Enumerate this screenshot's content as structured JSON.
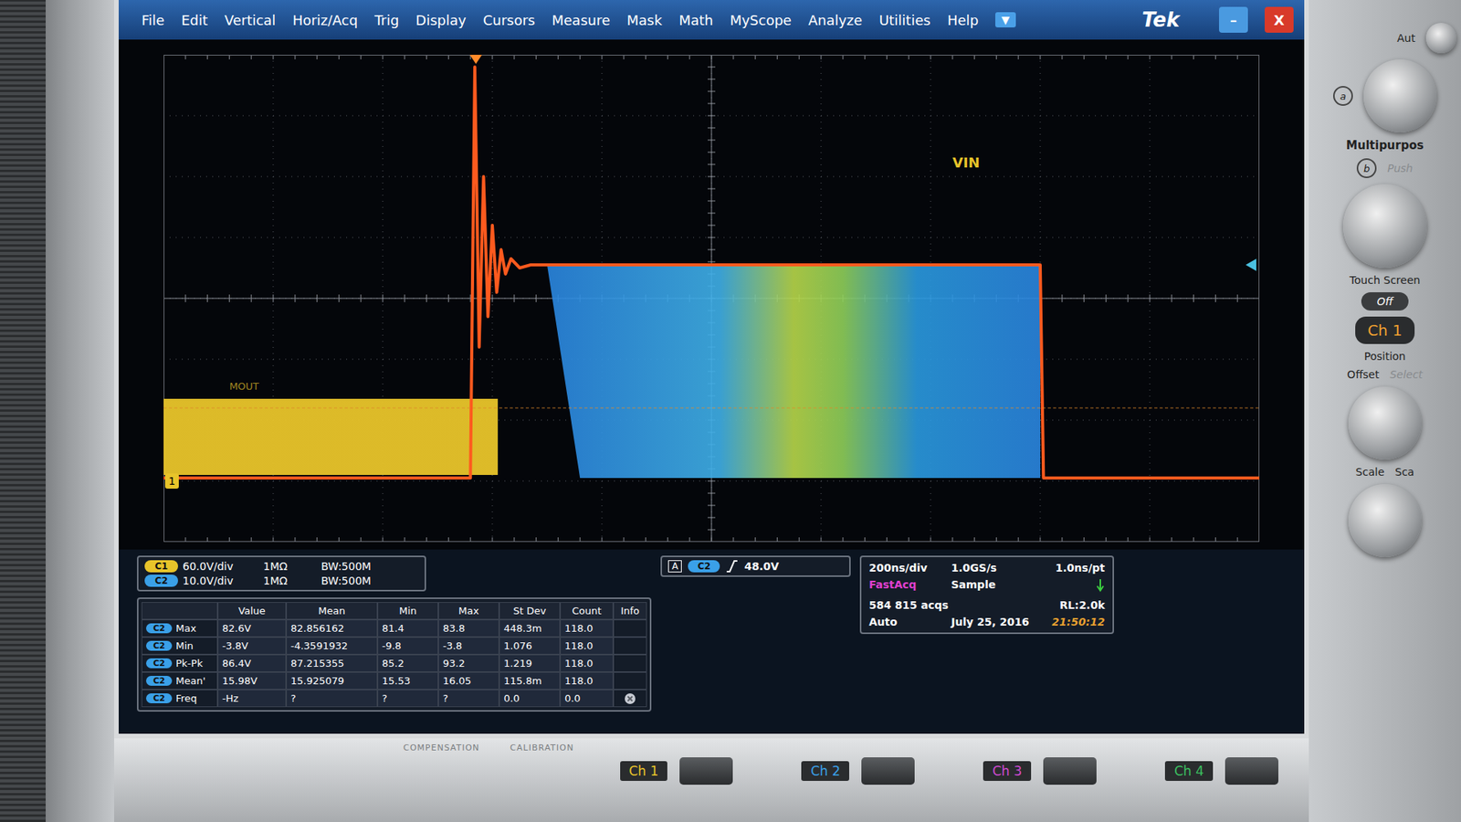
{
  "window": {
    "brand": "Tek",
    "menu": [
      "File",
      "Edit",
      "Vertical",
      "Horiz/Acq",
      "Trig",
      "Display",
      "Cursors",
      "Measure",
      "Mask",
      "Math",
      "MyScope",
      "Analyze",
      "Utilities",
      "Help"
    ],
    "dropdown": "▼",
    "minimize": "–",
    "close": "X"
  },
  "waveform": {
    "label": "VIN",
    "ref_label": "MOUT",
    "channel_marker": "1",
    "time_range_ns": [
      -1000,
      1000
    ],
    "volts_per_div": 10,
    "offset_div": -3,
    "series": [
      {
        "name": "envelope",
        "kind": "fill",
        "gradient": true,
        "color": "#2a86e0",
        "t": [
          -300,
          600,
          600,
          -240
        ],
        "v": [
          35.5,
          35.5,
          0.5,
          0.5
        ]
      },
      {
        "name": "band",
        "kind": "fill",
        "gradient": false,
        "color": "#e8c42a",
        "t": [
          -1000,
          -390,
          -390,
          -1000
        ],
        "v": [
          13.5,
          13.5,
          1,
          1
        ]
      },
      {
        "name": "trace",
        "kind": "line",
        "gradient": false,
        "color": "#ff5a1e",
        "t": [
          -1000,
          -440,
          -432,
          -424,
          -416,
          -408,
          -400,
          -392,
          -384,
          -376,
          -366,
          -350,
          -330,
          600,
          606,
          1000
        ],
        "v": [
          0.5,
          0.5,
          68,
          22,
          50,
          27,
          42,
          31,
          38,
          34,
          36.5,
          35,
          35.5,
          35.5,
          0.5,
          0.5
        ]
      }
    ]
  },
  "channels": [
    {
      "badge": "C1",
      "scale": "60.0V/div",
      "impedance": "1MΩ",
      "bandwidth": "BW:500M",
      "color": "#e8c42a"
    },
    {
      "badge": "C2",
      "scale": "10.0V/div",
      "impedance": "1MΩ",
      "bandwidth": "BW:500M",
      "color": "#3aa0e8"
    }
  ],
  "trigger": {
    "mode": "A",
    "source": "C2",
    "level": "48.0V"
  },
  "acquisition": {
    "timebase": "200ns/div",
    "sample_rate": "1.0GS/s",
    "resolution": "1.0ns/pt",
    "mode": "FastAcq",
    "sampling": "Sample",
    "acqs": "584 815 acqs",
    "record_length": "RL:2.0k",
    "trigger_mode": "Auto",
    "date": "July 25, 2016",
    "time": "21:50:12"
  },
  "measurements": {
    "columns": [
      "",
      "Value",
      "Mean",
      "Min",
      "Max",
      "St Dev",
      "Count",
      "Info"
    ],
    "rows": [
      {
        "source": "C2",
        "name": "Max",
        "cells": [
          "82.6V",
          "82.856162",
          "81.4",
          "83.8",
          "448.3m",
          "118.0"
        ],
        "warning": false
      },
      {
        "source": "C2",
        "name": "Min",
        "cells": [
          "-3.8V",
          "-4.3591932",
          "-9.8",
          "-3.8",
          "1.076",
          "118.0"
        ],
        "warning": false
      },
      {
        "source": "C2",
        "name": "Pk-Pk",
        "cells": [
          "86.4V",
          "87.215355",
          "85.2",
          "93.2",
          "1.219",
          "118.0"
        ],
        "warning": false
      },
      {
        "source": "C2",
        "name": "Mean'",
        "cells": [
          "15.98V",
          "15.925079",
          "15.53",
          "16.05",
          "115.8m",
          "118.0"
        ],
        "warning": false
      },
      {
        "source": "C2",
        "name": "Freq",
        "cells": [
          "-Hz",
          "?",
          "?",
          "?",
          "0.0",
          "0.0"
        ],
        "warning": true
      }
    ]
  },
  "front_panel": {
    "top_label": "Aut",
    "a": "a",
    "multipurpose": "Multipurpos",
    "b": "b",
    "push": "Push",
    "touch_screen": "Touch Screen",
    "touch_state": "Off",
    "ch_button": "Ch 1",
    "position": "Position",
    "offset": "Offset",
    "select": "Select",
    "scale": "Scale",
    "scale2": "Sca"
  },
  "bottom": {
    "labels": [
      "COMPENSATION",
      "CALIBRATION"
    ],
    "channels": [
      {
        "label": "Ch 1",
        "color": "#e8c42a"
      },
      {
        "label": "Ch 2",
        "color": "#3aa0e8"
      },
      {
        "label": "Ch 3",
        "color": "#d04ad0"
      },
      {
        "label": "Ch 4",
        "color": "#3cc060"
      }
    ]
  }
}
